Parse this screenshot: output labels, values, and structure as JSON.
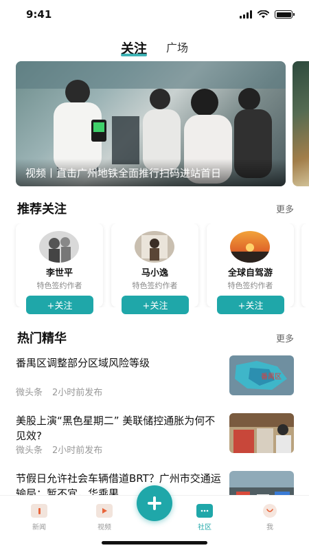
{
  "status": {
    "time": "9:41"
  },
  "tabs": [
    {
      "label": "关注",
      "active": true
    },
    {
      "label": "广场",
      "active": false
    }
  ],
  "banner": {
    "caption": "视频丨直击广州地铁全面推行扫码进站首日"
  },
  "recommend": {
    "title": "推荐关注",
    "more": "更多",
    "accent": "#bfe6e8",
    "authors": [
      {
        "name": "李世平",
        "role": "特色签约作者",
        "button": "+关注"
      },
      {
        "name": "马小逸",
        "role": "特色签约作者",
        "button": "+关注"
      },
      {
        "name": "全球自驾游",
        "role": "特色签约作者",
        "button": "+关注"
      }
    ]
  },
  "hot": {
    "title": "热门精华",
    "more": "更多",
    "accent": "#f8d3d3",
    "items": [
      {
        "title": "番禺区调整部分区域风险等级",
        "source": "微头条",
        "time": "2小时前发布",
        "thumb_label": "番禺区"
      },
      {
        "title": "美股上演“黑色星期二” 美联储控通胀为何不见效?",
        "source": "微头条",
        "time": "2小时前发布",
        "thumb_label": ""
      },
      {
        "title": "节假日允许社会车辆借道BRT？广州市交通运输局：暂不宜，华乘果",
        "source": "",
        "time": "",
        "thumb_label": ""
      }
    ]
  },
  "nav": {
    "items": [
      {
        "label": "新闻",
        "icon": "news-icon"
      },
      {
        "label": "视频",
        "icon": "video-icon"
      },
      {
        "label": "社区",
        "icon": "community-icon",
        "active": true
      },
      {
        "label": "我",
        "icon": "profile-icon"
      }
    ],
    "fab_icon": "plus-icon"
  },
  "colors": {
    "accent": "#1fa7a9"
  }
}
